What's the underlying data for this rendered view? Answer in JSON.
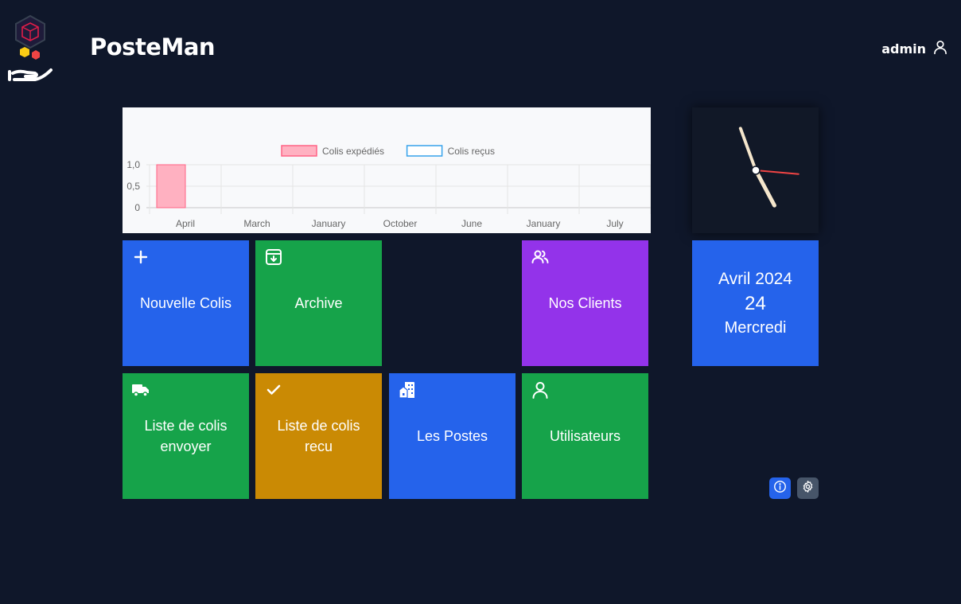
{
  "app": {
    "brand": "PosteMan"
  },
  "header": {
    "username": "admin"
  },
  "chart_data": {
    "type": "bar",
    "categories": [
      "April",
      "March",
      "January",
      "October",
      "June",
      "January",
      "July"
    ],
    "series": [
      {
        "name": "Colis expédiés",
        "values": [
          1,
          0,
          0,
          0,
          0,
          0,
          0
        ],
        "fill": "#ffb1c1",
        "stroke": "#ff6384"
      },
      {
        "name": "Colis reçus",
        "values": [
          0,
          0,
          0,
          0,
          0,
          0,
          0
        ],
        "fill": "#ffffff",
        "stroke": "#36a2eb"
      }
    ],
    "yticks": [
      "1,0",
      "0,5",
      "0"
    ],
    "ylim": [
      0,
      1
    ],
    "legend": "top",
    "grid": true
  },
  "clock": {
    "hour_hand_deg": 152,
    "minute_hand_deg": 340,
    "second_hand_deg": 95
  },
  "date": {
    "month_year": "Avril 2024",
    "day": "24",
    "weekday": "Mercredi"
  },
  "tiles": {
    "nouvelle_colis": {
      "label": "Nouvelle Colis",
      "icon": "plus-icon"
    },
    "archive": {
      "label": "Archive",
      "icon": "archive-icon"
    },
    "nos_clients": {
      "label": "Nos Clients",
      "icon": "users-icon"
    },
    "liste_envoyer": {
      "label": "Liste de colis envoyer",
      "icon": "truck-icon"
    },
    "liste_recu": {
      "label": "Liste de colis recu",
      "icon": "check-icon"
    },
    "les_postes": {
      "label": "Les Postes",
      "icon": "building-icon"
    },
    "utilisateurs": {
      "label": "Utilisateurs",
      "icon": "user-icon"
    }
  },
  "colors": {
    "background": "#0f172a",
    "blue": "#2563eb",
    "green": "#16a34a",
    "purple": "#9333ea",
    "amber": "#ca8a04"
  },
  "fabs": {
    "info": "info-icon",
    "settings": "gear-icon"
  }
}
